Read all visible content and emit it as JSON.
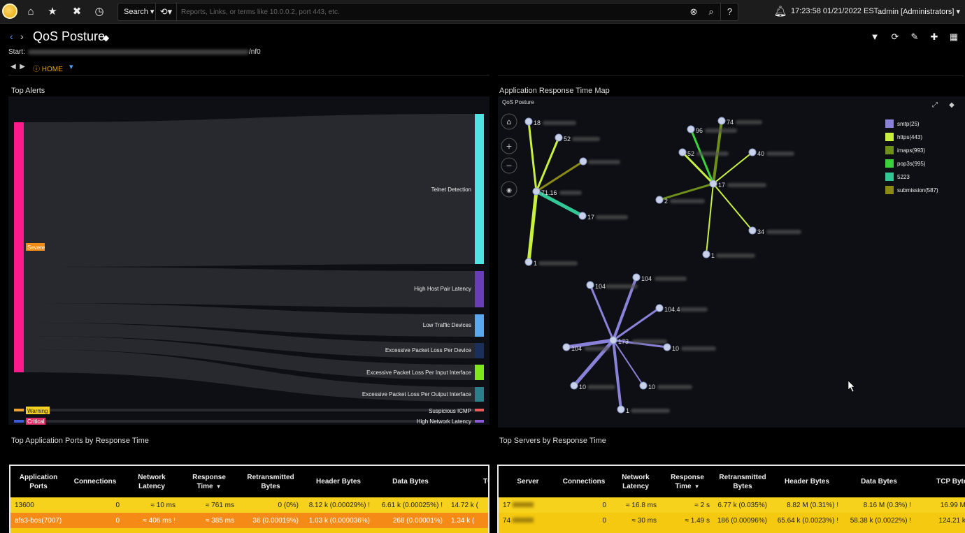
{
  "topbar": {
    "search_label": "Search",
    "search_placeholder": "Reports, Links, or terms like 10.0.0.2, port 443, etc.",
    "clock": "17:23:58 01/21/2022 EST",
    "user": "admin [Administrators]"
  },
  "page": {
    "title": "QoS Posture",
    "start_label": "Start:",
    "start_suffix": "/nf0",
    "home_crumb": "HOME"
  },
  "top_alerts": {
    "title": "Top Alerts",
    "sources": [
      {
        "label": "Severe",
        "color": "#ff1a8c"
      },
      {
        "label": "Warning",
        "color": "#f0a030"
      },
      {
        "label": "Critical",
        "color": "#3d5bd6"
      }
    ],
    "targets": [
      {
        "label": "Telnet Detection",
        "color": "#50e3e3"
      },
      {
        "label": "High Host Pair Latency",
        "color": "#6a3db8"
      },
      {
        "label": "Low Traffic Devices",
        "color": "#5aa8f0"
      },
      {
        "label": "Excessive Packet Loss Per Device",
        "color": "#1a2f5a"
      },
      {
        "label": "Excessive Packet Loss Per Input Interface",
        "color": "#7ee81a"
      },
      {
        "label": "Excessive Packet Loss Per Output Interface",
        "color": "#2a7f8a"
      },
      {
        "label": "Suspicious ICMP",
        "color": "#f05a5a"
      },
      {
        "label": "High Network Latency",
        "color": "#8a5ad6"
      }
    ]
  },
  "response_map": {
    "title": "Application Response Time Map",
    "subtitle": "QoS Posture",
    "legend": [
      {
        "label": "smtp(25)",
        "color": "#8a82d8"
      },
      {
        "label": "https(443)",
        "color": "#c8f03c"
      },
      {
        "label": "imaps(993)",
        "color": "#6e8f1a"
      },
      {
        "label": "pop3s(995)",
        "color": "#3cd23c"
      },
      {
        "label": "5223",
        "color": "#32c896"
      },
      {
        "label": "submission(587)",
        "color": "#8a8a14"
      }
    ],
    "node_labels": {
      "a1": "18",
      "a2": "52",
      "a4": "71.16",
      "a5": "17",
      "a6": "1",
      "b1": "74",
      "b2": "96",
      "b3": "52",
      "b4": "40",
      "b5": "17",
      "b6": "2",
      "b7": "34",
      "b8": "1",
      "c1": "104",
      "c2": "104",
      "c3": "104.4",
      "c4": "173",
      "c5": "104",
      "c6": "10",
      "c7": "10",
      "c8": "10",
      "c9": "1"
    }
  },
  "ports_table": {
    "title": "Top Application Ports by Response Time",
    "columns": [
      "Application Ports",
      "Connections",
      "Network Latency",
      "Response Time",
      "Retransmitted Bytes",
      "Header Bytes",
      "Data Bytes",
      "TCP"
    ],
    "rows": [
      [
        "13600",
        "0",
        "≈ 10 ms",
        "≈ 761 ms",
        "0 (0%)",
        "8.12 k (0.00029%) !",
        "6.61 k (0.00025%) !",
        "14.72 k ("
      ],
      [
        "afs3-bos(7007)",
        "0",
        "≈ 406 ms !",
        "≈ 385 ms",
        "36 (0.00019%)",
        "1.03 k (0.000036%)",
        "268 (0.00001%)",
        "1.34 k ("
      ]
    ]
  },
  "servers_table": {
    "title": "Top Servers by Response Time",
    "columns": [
      "Server",
      "Connections",
      "Network Latency",
      "Response Time",
      "Retransmitted Bytes",
      "Header Bytes",
      "Data Bytes",
      "TCP Bytes"
    ],
    "rows": [
      [
        "17",
        "0",
        "≈ 16.8 ms",
        "≈ 2 s",
        "6.77 k (0.035%)",
        "8.82 M (0.31%) !",
        "8.16 M (0.3%) !",
        "16.99 M ("
      ],
      [
        "74",
        "0",
        "≈ 30 ms",
        "≈ 1.49 s",
        "186 (0.00096%)",
        "65.64 k (0.0023%) !",
        "58.38 k (0.0022%) !",
        "124.21 k ("
      ]
    ]
  }
}
